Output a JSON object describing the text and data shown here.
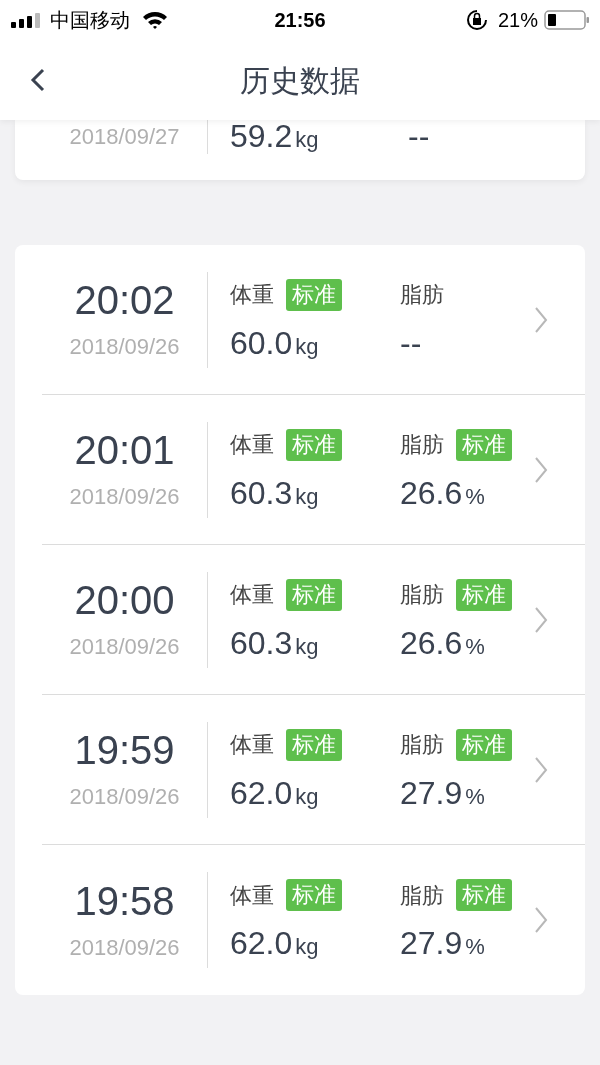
{
  "status_bar": {
    "carrier": "中国移动",
    "time": "21:56",
    "battery": "21%"
  },
  "header": {
    "title": "历史数据"
  },
  "partial_record": {
    "date": "2018/09/27",
    "weight": "59.2",
    "weight_unit": "kg",
    "fat": "--"
  },
  "records": [
    {
      "time": "20:02",
      "date": "2018/09/26",
      "weight_label": "体重",
      "weight_tag": "标准",
      "weight": "60.0",
      "weight_unit": "kg",
      "fat_label": "脂肪",
      "fat": "--"
    },
    {
      "time": "20:01",
      "date": "2018/09/26",
      "weight_label": "体重",
      "weight_tag": "标准",
      "weight": "60.3",
      "weight_unit": "kg",
      "fat_label": "脂肪",
      "fat_tag": "标准",
      "fat": "26.6",
      "fat_unit": "%"
    },
    {
      "time": "20:00",
      "date": "2018/09/26",
      "weight_label": "体重",
      "weight_tag": "标准",
      "weight": "60.3",
      "weight_unit": "kg",
      "fat_label": "脂肪",
      "fat_tag": "标准",
      "fat": "26.6",
      "fat_unit": "%"
    },
    {
      "time": "19:59",
      "date": "2018/09/26",
      "weight_label": "体重",
      "weight_tag": "标准",
      "weight": "62.0",
      "weight_unit": "kg",
      "fat_label": "脂肪",
      "fat_tag": "标准",
      "fat": "27.9",
      "fat_unit": "%"
    },
    {
      "time": "19:58",
      "date": "2018/09/26",
      "weight_label": "体重",
      "weight_tag": "标准",
      "weight": "62.0",
      "weight_unit": "kg",
      "fat_label": "脂肪",
      "fat_tag": "标准",
      "fat": "27.9",
      "fat_unit": "%"
    }
  ]
}
